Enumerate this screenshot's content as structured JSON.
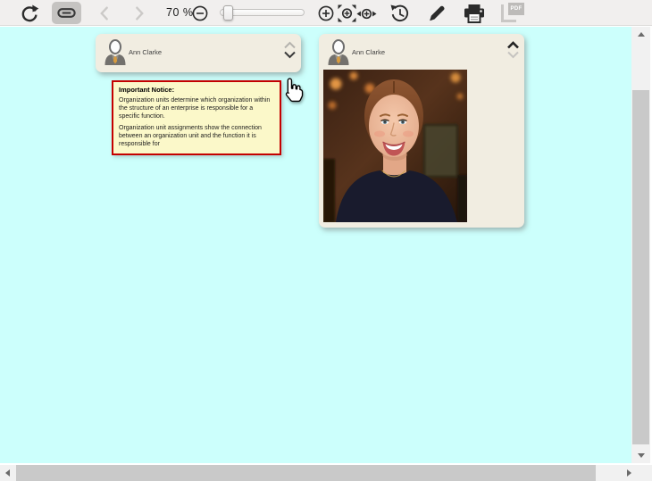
{
  "toolbar": {
    "zoom_level": "70 %",
    "pdf_label": "PDF"
  },
  "canvas": {
    "cards": [
      {
        "name": "Ann Clarke"
      },
      {
        "name": "Ann Clarke"
      }
    ],
    "notice": {
      "title": "Important Notice:",
      "body": [
        "Organization units determine which organization within the structure of an enterprise is responsible for a specific function.",
        "Organization unit assignments show the connection between an organization unit and the function it is responsible for"
      ]
    }
  },
  "colors": {
    "canvas_background": "#ccfffc",
    "toolbar_background": "#f1efee",
    "toolbar_active_button": "#c5c3c1",
    "card_background": "#f1ede1",
    "notice_background": "#fbf8c9",
    "notice_border": "#c40000",
    "icon_dark": "#2b2b2b",
    "icon_disabled": "#c9c7c5",
    "scrollbar_thumb": "#c9c9c9",
    "scrollbar_track": "#f1f1f1",
    "avatar_tie": "#d79b3f"
  },
  "icons": {
    "toolbar": [
      "refresh-icon",
      "link-icon",
      "chevron-left-icon",
      "chevron-right-icon",
      "minus-circle-icon",
      "plus-circle-icon",
      "zoom-fit-icon",
      "zoom-width-icon",
      "history-icon",
      "pencil-icon",
      "printer-icon",
      "pdf-icon"
    ],
    "cards": [
      "person-icon",
      "chevron-up-icon",
      "chevron-down-icon"
    ],
    "pointer": "hand-cursor"
  }
}
